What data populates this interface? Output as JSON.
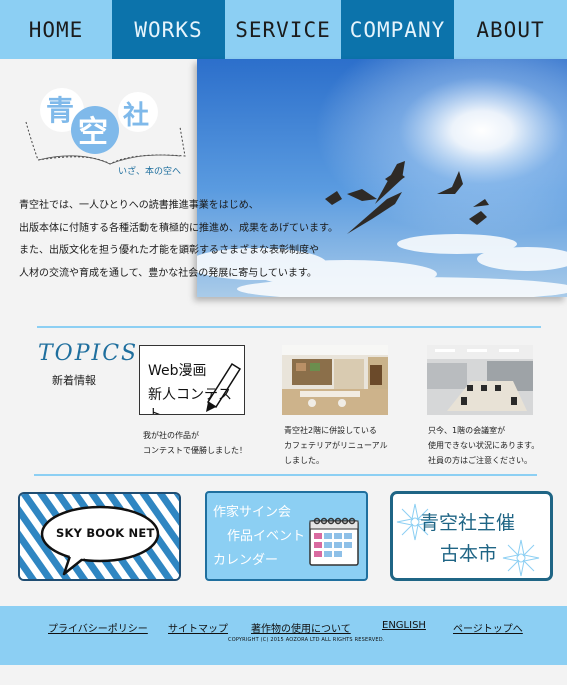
{
  "nav": {
    "items": [
      {
        "label": "HOME"
      },
      {
        "label": "WORKS"
      },
      {
        "label": "SERVICE"
      },
      {
        "label": "COMPANY"
      },
      {
        "label": "ABOUT"
      }
    ]
  },
  "logo": {
    "char1": "青",
    "char2": "空",
    "char3": "社",
    "tagline": "いざ、本の空へ"
  },
  "intro": {
    "lines": [
      "青空社では、一人ひとりへの読書推進事業をはじめ、",
      "出版本体に付随する各種活動を積極的に推進め、成果をあげています。",
      "また、出版文化を担う優れた才能を顕彰するさまざまな表彰制度や",
      "人材の交流や育成を通して、豊かな社会の発展に寄与しています。"
    ]
  },
  "topics": {
    "title": "TOPICS",
    "subtitle": "新着情報",
    "items": [
      {
        "thumb_line1": "Web漫画",
        "thumb_line2": "新人コンテスト",
        "text_line1": "我が社の作品が",
        "text_line2": "コンテストで優勝しました！",
        "text_line3": ""
      },
      {
        "text_line1": "青空社2階に併設している",
        "text_line2": "カフェテリアがリニューアル",
        "text_line3": "しました。"
      },
      {
        "text_line1": "只今、1階の会議室が",
        "text_line2": "使用できない状況にあります。",
        "text_line3": "社員の方はご注意ください。"
      }
    ]
  },
  "banners": {
    "skybook": {
      "label": "SKY BOOK NET"
    },
    "calendar": {
      "line1": "作家サイン会",
      "line2": "作品イベント",
      "line3": "カレンダー"
    },
    "fair": {
      "line1": "青空社主催",
      "line2": "古本市"
    }
  },
  "footer": {
    "links": [
      {
        "label": "プライバシーポリシー"
      },
      {
        "label": "サイトマップ"
      },
      {
        "label": "著作物の使用について"
      },
      {
        "label": "ENGLISH"
      },
      {
        "label": "ページトップへ"
      }
    ],
    "copyright": "COPYRIGHT (C) 2015 AOZORA LTD ALL RIGHTS RESERVED."
  },
  "colors": {
    "nav_light": "#8ccff3",
    "nav_dark": "#0c73ab",
    "accent": "#1f6f9e",
    "background": "#f3f3f3"
  }
}
